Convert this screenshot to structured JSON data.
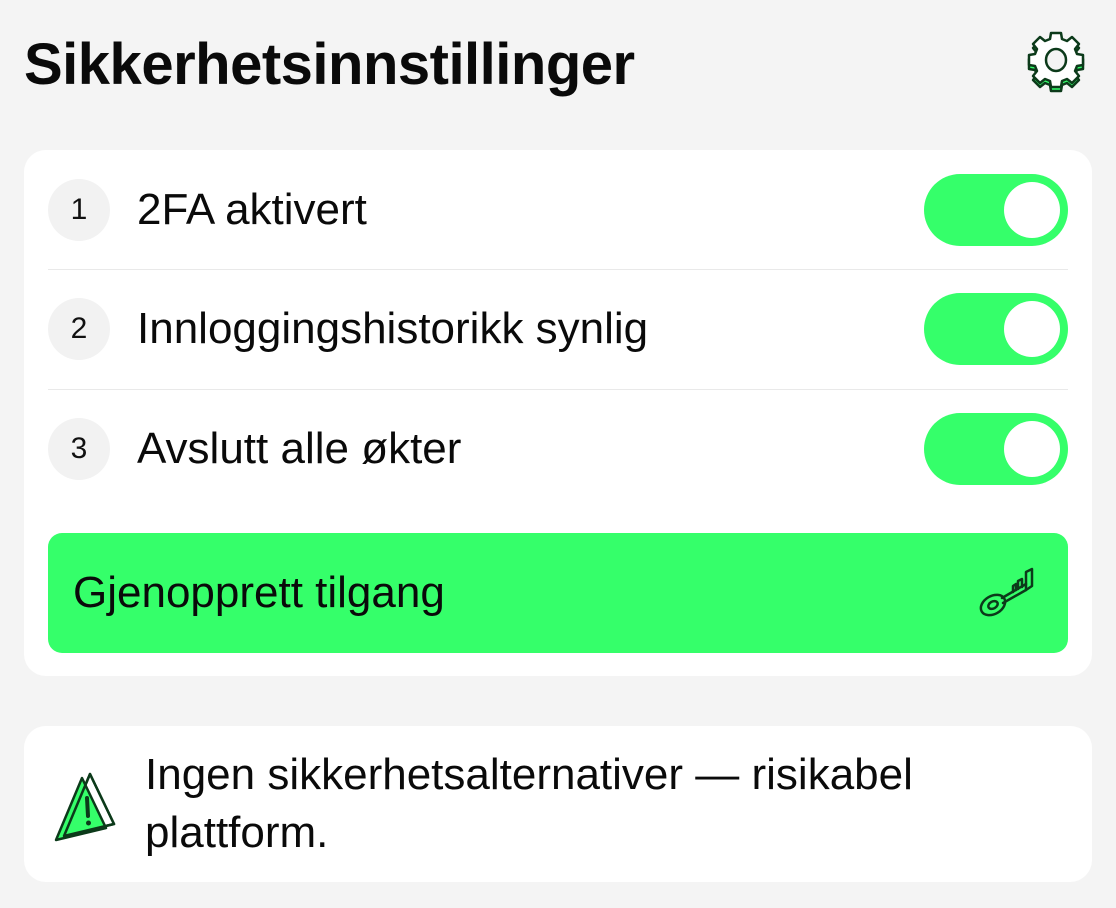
{
  "header": {
    "title": "Sikkerhetsinnstillinger",
    "settings_icon": "gear-icon"
  },
  "settings": {
    "items": [
      {
        "number": "1",
        "label": "2FA aktivert",
        "enabled": true
      },
      {
        "number": "2",
        "label": "Innloggingshistorikk synlig",
        "enabled": true
      },
      {
        "number": "3",
        "label": "Avslutt alle økter",
        "enabled": true
      }
    ],
    "restore_button": {
      "label": "Gjenopprett tilgang",
      "icon": "key-icon"
    }
  },
  "warning": {
    "icon": "warning-triangle-icon",
    "text": "Ingen sikkerhetsalternativer — risikabel plattform."
  },
  "colors": {
    "accent": "#35ff6a",
    "background": "#f4f4f4",
    "card": "#ffffff",
    "text": "#0a0a0a",
    "icon_stroke": "#0c3a1a"
  }
}
